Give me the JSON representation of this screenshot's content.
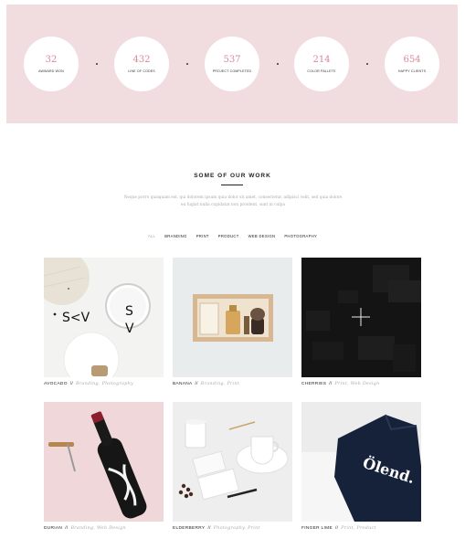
{
  "stats": [
    {
      "value": "32",
      "label": "AWWARD WON"
    },
    {
      "value": "432",
      "label": "LINE OF CODES"
    },
    {
      "value": "537",
      "label": "PROJECT COMPLETED"
    },
    {
      "value": "214",
      "label": "COLOR PALLETE"
    },
    {
      "value": "654",
      "label": "HAPPY CLIENTS"
    }
  ],
  "work": {
    "title": "SOME OF OUR WORK",
    "intro_line1": "Neque porro quisquam est, qui dolorem ipsum quia dolor sit amet, consectetur, adipisci velit, sed quia dolore",
    "intro_line2": "eu fugiat nulla cupidatat non proident, sunt in culpa",
    "filters": [
      "ALL",
      "BRANDING",
      "PRINT",
      "PRODUCT",
      "WEB DESIGN",
      "PHOTOGRAPHY"
    ],
    "items": [
      {
        "name": "AVOCADO",
        "sep": "//",
        "cats": "Branding, Photography"
      },
      {
        "name": "BANANA",
        "sep": "//",
        "cats": "Branding, Print"
      },
      {
        "name": "CHERRIES",
        "sep": "//",
        "cats": "Print, Web Design"
      },
      {
        "name": "DURIAN",
        "sep": "//",
        "cats": "Branding, Web Design"
      },
      {
        "name": "ELDERBERRY",
        "sep": "//",
        "cats": "Photography, Print"
      },
      {
        "name": "FINGER LIME",
        "sep": "//",
        "cats": "Print, Product"
      }
    ],
    "logo_text_1": "S<V",
    "logo_text_2": "S",
    "logo_text_3": "V",
    "bottle_mark": "Ölend."
  }
}
